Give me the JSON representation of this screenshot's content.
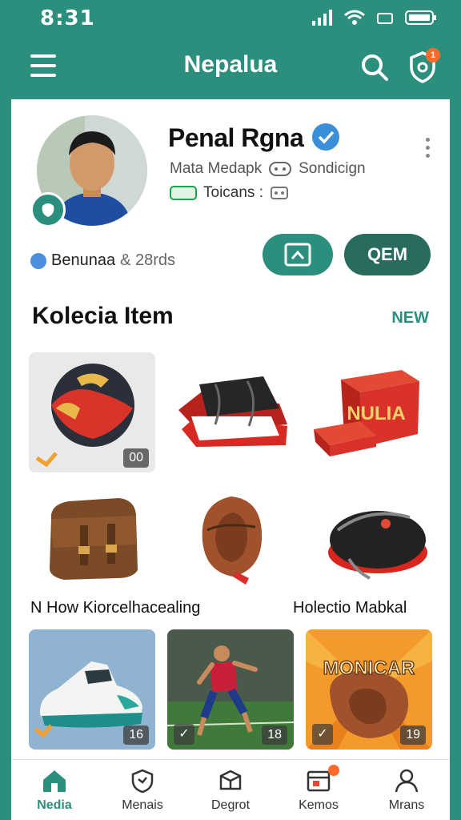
{
  "status_bar": {
    "time": "8:31"
  },
  "app_bar": {
    "title": "Nepalua",
    "notification_count": "1"
  },
  "profile": {
    "name": "Penal Rgna",
    "subtitle": "Mata Medapk",
    "subtitle_extra": "Sondicign",
    "tokens_label": "Toicans :",
    "followers_name": "Benunaa",
    "followers_count": "& 28rds",
    "action_button_label": "QEM"
  },
  "section": {
    "title": "Kolecia Item",
    "link": "NEW"
  },
  "items_row1": [
    {
      "name": "basketball",
      "count": "00"
    },
    {
      "name": "jersey-bag"
    },
    {
      "name": "nulia-box",
      "box_text": "NULIA"
    }
  ],
  "items_row2": [
    {
      "name": "leather-bag"
    },
    {
      "name": "baseball-glove"
    },
    {
      "name": "padded-mitt"
    }
  ],
  "row_labels": {
    "left": "N How Kiorcelhacealing",
    "right": "Holectio Mabkal"
  },
  "items_row3": [
    {
      "name": "sneaker",
      "count": "16"
    },
    {
      "name": "footballer",
      "count": "18"
    },
    {
      "name": "monicar-glove",
      "count": "19",
      "badge_text": "MONICAR"
    }
  ],
  "bottom_nav": [
    {
      "label": "Nedia",
      "icon": "home-icon",
      "active": true
    },
    {
      "label": "Menais",
      "icon": "shield-icon",
      "active": false
    },
    {
      "label": "Degrot",
      "icon": "box-icon",
      "active": false
    },
    {
      "label": "Kemos",
      "icon": "calendar-icon",
      "active": false
    },
    {
      "label": "Mrans",
      "icon": "person-icon",
      "active": false
    }
  ],
  "colors": {
    "primary": "#2c8f7e",
    "dark_button": "#2a6b5f",
    "accent": "#ff6a2a"
  }
}
